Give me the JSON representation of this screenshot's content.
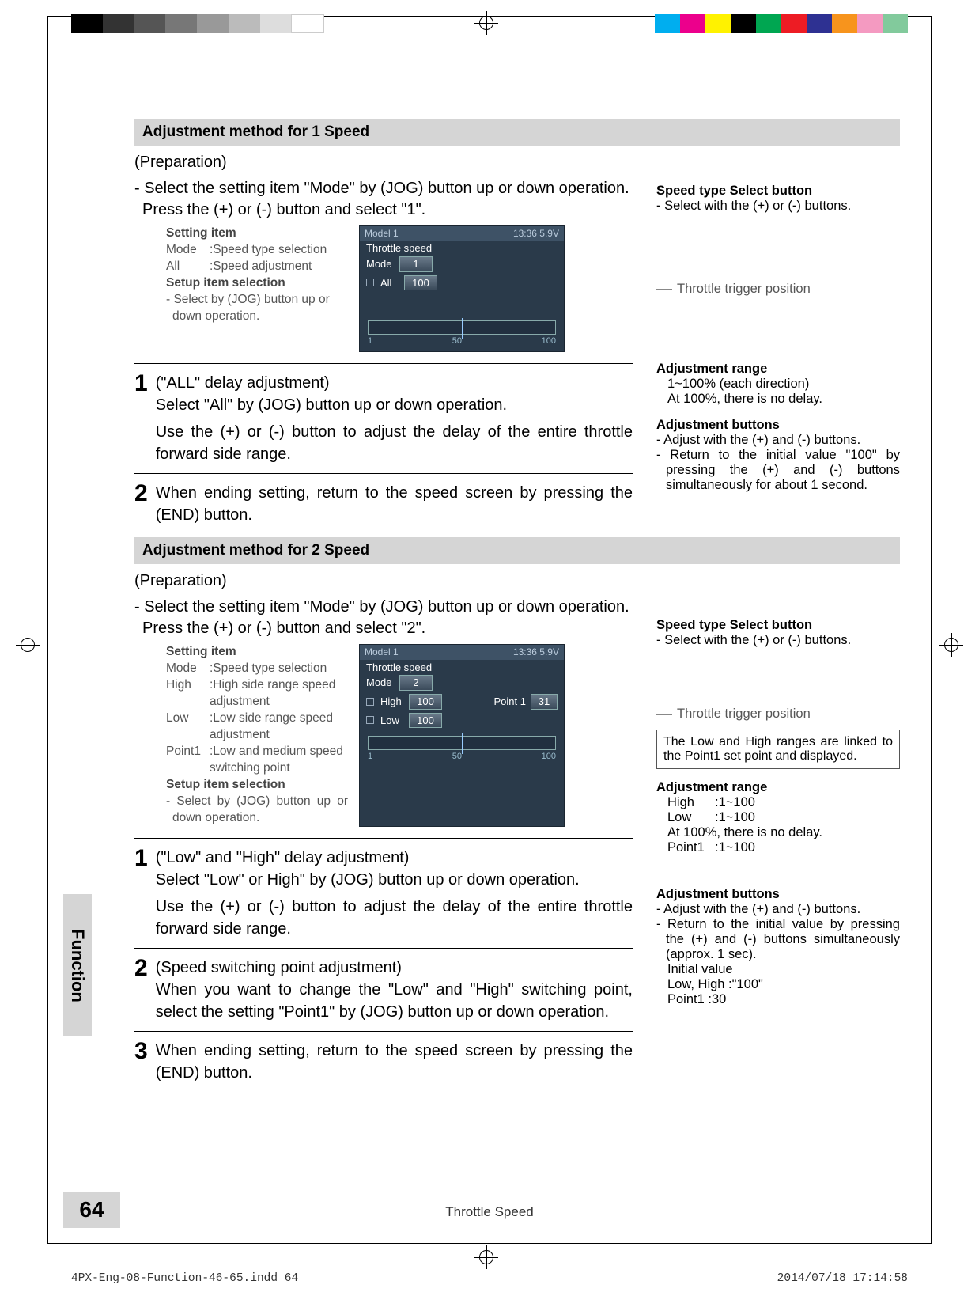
{
  "page": {
    "number": "64",
    "footer_title": "Throttle Speed",
    "side_tab": "Function",
    "imprint_file": "4PX-Eng-08-Function-46-65.indd   64",
    "imprint_date": "2014/07/18   17:14:58"
  },
  "color_bars_left": [
    "#000",
    "#333",
    "#555",
    "#777",
    "#999",
    "#bbb",
    "#ddd",
    "#fff"
  ],
  "color_bars_right": [
    "#00aeef",
    "#ec008c",
    "#fff200",
    "#000",
    "#00a651",
    "#ed1c24",
    "#2e3192",
    "#f7941d",
    "#f49ac1",
    "#82ca9c"
  ],
  "sec1": {
    "header": "Adjustment method for 1 Speed",
    "prep": "(Preparation)",
    "intro": "- Select the setting item \"Mode\" by (JOG) button up or down operation. Press the (+) or (-) button and select \"1\".",
    "setting": {
      "title": "Setting item",
      "mode_k": "Mode",
      "mode_v": ":Speed type selection",
      "all_k": "All",
      "all_v": ":Speed adjustment",
      "setup_title": "Setup item selection",
      "setup_text": "- Select by (JOG) button up or down operation."
    },
    "lcd": {
      "model": "Model 1",
      "time": "13:36 5.9V",
      "title": "Throttle speed",
      "mode_label": "Mode",
      "mode_val": "1",
      "all_label": "All",
      "all_val": "100",
      "scale_1": "1",
      "scale_50": "50",
      "scale_100": "100"
    },
    "side": {
      "sel_title": "Speed type Select button",
      "sel_text": "- Select with the (+) or (-) buttons.",
      "trigger": "Throttle trigger position",
      "range_title": "Adjustment  range",
      "range_l1": "1~100% (each direction)",
      "range_l2": "At 100%, there is no delay.",
      "btn_title": "Adjustment buttons",
      "btn_l1": "- Adjust with the (+) and (-) buttons.",
      "btn_l2": "- Return to the initial value \"100\" by pressing the (+) and (-) buttons simultaneously for about 1 second."
    },
    "step1_title": "(\"ALL\" delay adjustment)",
    "step1_a": "Select \"All\" by (JOG) button up or down operation.",
    "step1_b": "Use the (+) or (-) button to adjust the delay of the entire throttle forward side range.",
    "step2": "When ending setting, return to the speed screen by pressing the (END) button."
  },
  "sec2": {
    "header": "Adjustment method for 2 Speed",
    "prep": "(Preparation)",
    "intro": "- Select the setting item \"Mode\" by (JOG) button up or down operation. Press the (+) or (-) button and select \"2\".",
    "setting": {
      "title": "Setting item",
      "mode_k": "Mode",
      "mode_v": ":Speed type selection",
      "high_k": "High",
      "high_v": ":High side range speed adjustment",
      "low_k": "Low",
      "low_v": ":Low side range speed adjustment",
      "pt_k": "Point1",
      "pt_v": ":Low and medium speed switching point",
      "setup_title": "Setup item selection",
      "setup_text": "- Select by (JOG) button up or down operation."
    },
    "lcd": {
      "model": "Model 1",
      "time": "13:36 5.9V",
      "title": "Throttle speed",
      "mode_label": "Mode",
      "mode_val": "2",
      "high_label": "High",
      "high_val": "100",
      "pt_label": "Point 1",
      "pt_val": "31",
      "low_label": "Low",
      "low_val": "100",
      "scale_1": "1",
      "scale_50": "50",
      "scale_100": "100"
    },
    "side": {
      "sel_title": "Speed type Select button",
      "sel_text": "- Select with the (+) or (-) buttons.",
      "trigger": "Throttle trigger position",
      "info_box": "The Low and High ranges are linked to the Point1 set point and displayed.",
      "range_title": "Adjustment  range",
      "r_high_k": "High",
      "r_high_v": ":1~100",
      "r_low_k": "Low",
      "r_low_v": ":1~100",
      "r_delay": "At 100%, there is no delay.",
      "r_pt_k": "Point1",
      "r_pt_v": ":1~100",
      "btn_title": "Adjustment buttons",
      "btn_l1": "- Adjust with the (+) and (-) buttons.",
      "btn_l2": "- Return to the initial value by pressing the (+) and (-) buttons simultaneously (approx. 1 sec).",
      "btn_l3": "Initial value",
      "btn_l4": "Low, High :\"100\"",
      "btn_l5": "Point1 :30"
    },
    "step1_title": "(\"Low\" and \"High\" delay adjustment)",
    "step1_a": "Select \"Low\" or High\" by (JOG) button up or down operation.",
    "step1_b": "Use the (+) or (-) button to adjust the delay of the entire throttle forward side range.",
    "step2_title": "(Speed switching point adjustment)",
    "step2_a": "When you want to change the \"Low\" and \"High\" switching point, select the setting \"Point1\" by (JOG) button up or down operation.",
    "step3": "When ending setting, return to the speed screen by pressing the (END) button."
  }
}
